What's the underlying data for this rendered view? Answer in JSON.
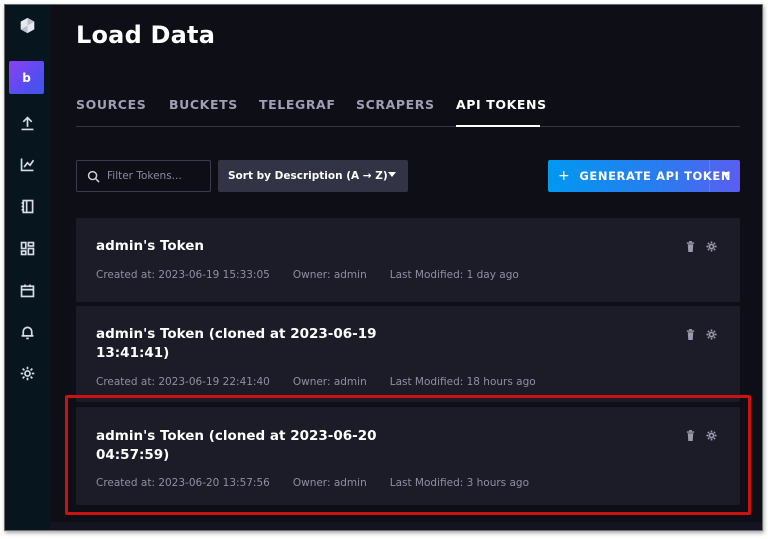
{
  "page": {
    "title": "Load Data"
  },
  "sidebar": {
    "org_initial": "b",
    "items": [
      {
        "icon": "logo-cube-icon"
      },
      {
        "icon": "upload-icon"
      },
      {
        "icon": "chart-icon"
      },
      {
        "icon": "notebook-icon"
      },
      {
        "icon": "dashboard-icon"
      },
      {
        "icon": "calendar-icon"
      },
      {
        "icon": "bell-icon"
      },
      {
        "icon": "gear-icon"
      }
    ]
  },
  "tabs": [
    {
      "label": "SOURCES",
      "active": false
    },
    {
      "label": "BUCKETS",
      "active": false
    },
    {
      "label": "TELEGRAF",
      "active": false
    },
    {
      "label": "SCRAPERS",
      "active": false
    },
    {
      "label": "API TOKENS",
      "active": true
    }
  ],
  "search": {
    "placeholder": "Filter Tokens..."
  },
  "sort": {
    "label": "Sort by Description (A → Z)"
  },
  "generate": {
    "label": "GENERATE API TOKEN"
  },
  "tokens": [
    {
      "name": "admin's Token",
      "created": "Created at: 2023-06-19 15:33:05",
      "owner": "Owner: admin",
      "modified": "Last Modified: 1 day ago"
    },
    {
      "name": "admin's Token (cloned at 2023-06-19 13:41:41)",
      "created": "Created at: 2023-06-19 22:41:40",
      "owner": "Owner: admin",
      "modified": "Last Modified: 18 hours ago"
    },
    {
      "name": "admin's Token (cloned at 2023-06-20 04:57:59)",
      "created": "Created at: 2023-06-20 13:57:56",
      "owner": "Owner: admin",
      "modified": "Last Modified: 3 hours ago"
    }
  ],
  "colors": {
    "accent": "#0098f0",
    "background": "#0e0e16",
    "card": "#1c1c28",
    "highlight": "#cc1111"
  }
}
